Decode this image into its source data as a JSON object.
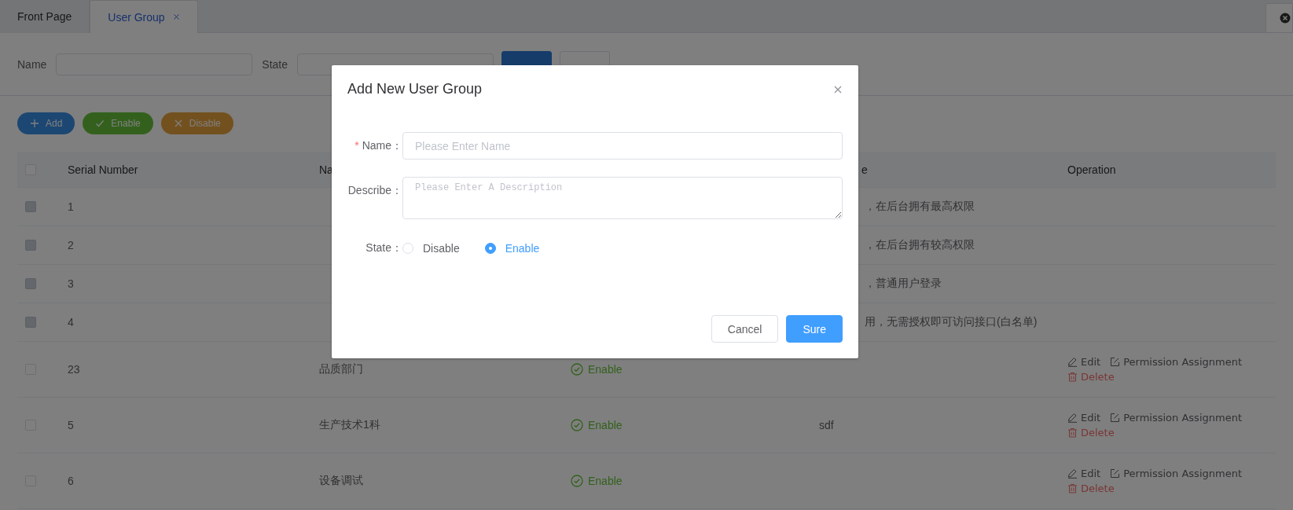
{
  "tabs": [
    {
      "label": "Front Page",
      "selected": false,
      "closable": false
    },
    {
      "label": "User Group",
      "selected": true,
      "closable": true
    }
  ],
  "filters": {
    "name_label": "Name",
    "state_label": "State"
  },
  "filter_buttons": [
    {
      "kind": "primary"
    },
    {
      "kind": "plain"
    }
  ],
  "actions": [
    {
      "label": "Add",
      "kind": "add"
    },
    {
      "label": "Enable",
      "kind": "enable"
    },
    {
      "label": "Disable",
      "kind": "disable"
    }
  ],
  "table": {
    "header": {
      "checked": false,
      "serial_number": "Serial Number",
      "column_3": "Na",
      "column_5": "e",
      "operation": "Operation"
    },
    "rows": [
      {
        "checked": false,
        "disabled": true,
        "serial_number": "1",
        "column_5": "，在后台拥有最高权限"
      },
      {
        "checked": false,
        "disabled": true,
        "serial_number": "2",
        "column_5": "，在后台拥有较高权限"
      },
      {
        "checked": false,
        "disabled": true,
        "serial_number": "3",
        "column_5": "，普通用户登录"
      },
      {
        "checked": false,
        "disabled": true,
        "serial_number": "4",
        "column_5": "用，无需授权即可访问接口(白名单)"
      },
      {
        "checked": false,
        "disabled": false,
        "serial_number": "23",
        "column_3": "品质部门",
        "state": "Enable",
        "operations": [
          {
            "label": "Edit",
            "kind": "edit"
          },
          {
            "label": "Permission Assignment",
            "kind": "permission"
          },
          {
            "label": "Delete",
            "kind": "delete"
          }
        ]
      },
      {
        "checked": false,
        "disabled": false,
        "serial_number": "5",
        "column_3": "生产技术1科",
        "state": "Enable",
        "column_5": "sdf",
        "operations": [
          {
            "label": "Edit",
            "kind": "edit"
          },
          {
            "label": "Permission Assignment",
            "kind": "permission"
          },
          {
            "label": "Delete",
            "kind": "delete"
          }
        ]
      },
      {
        "checked": false,
        "disabled": false,
        "serial_number": "6",
        "column_3": "设备调试",
        "state": "Enable",
        "operations": [
          {
            "label": "Edit",
            "kind": "edit"
          },
          {
            "label": "Permission Assignment",
            "kind": "permission"
          },
          {
            "label": "Delete",
            "kind": "delete"
          }
        ]
      }
    ]
  },
  "modal": {
    "title": "Add New User Group",
    "fields": [
      {
        "kind": "input",
        "required_mark": "*",
        "label": "Name：",
        "placeholder": "Please Enter Name"
      },
      {
        "kind": "textarea",
        "label": "Describe：",
        "placeholder": "Please Enter A Description"
      },
      {
        "kind": "radio",
        "label": "State：",
        "options": [
          {
            "label": "Disable",
            "selected": false
          },
          {
            "label": "Enable",
            "selected": true
          }
        ]
      }
    ],
    "buttons": [
      {
        "label": "Cancel",
        "kind": "plain"
      },
      {
        "label": "Sure",
        "kind": "primary"
      }
    ]
  }
}
